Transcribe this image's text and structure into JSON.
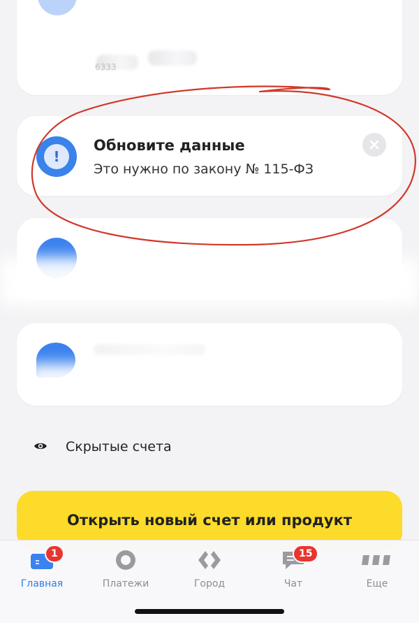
{
  "top_card": {
    "masked_number": "6333"
  },
  "notice": {
    "title": "Обновите данные",
    "subtitle": "Это нужно по закону № 115-ФЗ"
  },
  "hidden_accounts": {
    "label": "Скрытые счета"
  },
  "cta": {
    "label": "Открыть новый счет или продукт"
  },
  "tabbar": {
    "items": [
      {
        "label": "Главная",
        "icon": "home-card-icon",
        "badge": "1",
        "active": true
      },
      {
        "label": "Платежи",
        "icon": "payments-circle-icon",
        "badge": "",
        "active": false
      },
      {
        "label": "Город",
        "icon": "city-diamond-icon",
        "badge": "",
        "active": false
      },
      {
        "label": "Чат",
        "icon": "chat-bubble-icon",
        "badge": "15",
        "active": false
      },
      {
        "label": "Еще",
        "icon": "more-icon",
        "badge": "",
        "active": false
      }
    ]
  },
  "colors": {
    "accent": "#2d7bea",
    "cta_yellow": "#fddb2a",
    "badge_red": "#e9352f",
    "annotation_red": "#d0392a"
  }
}
